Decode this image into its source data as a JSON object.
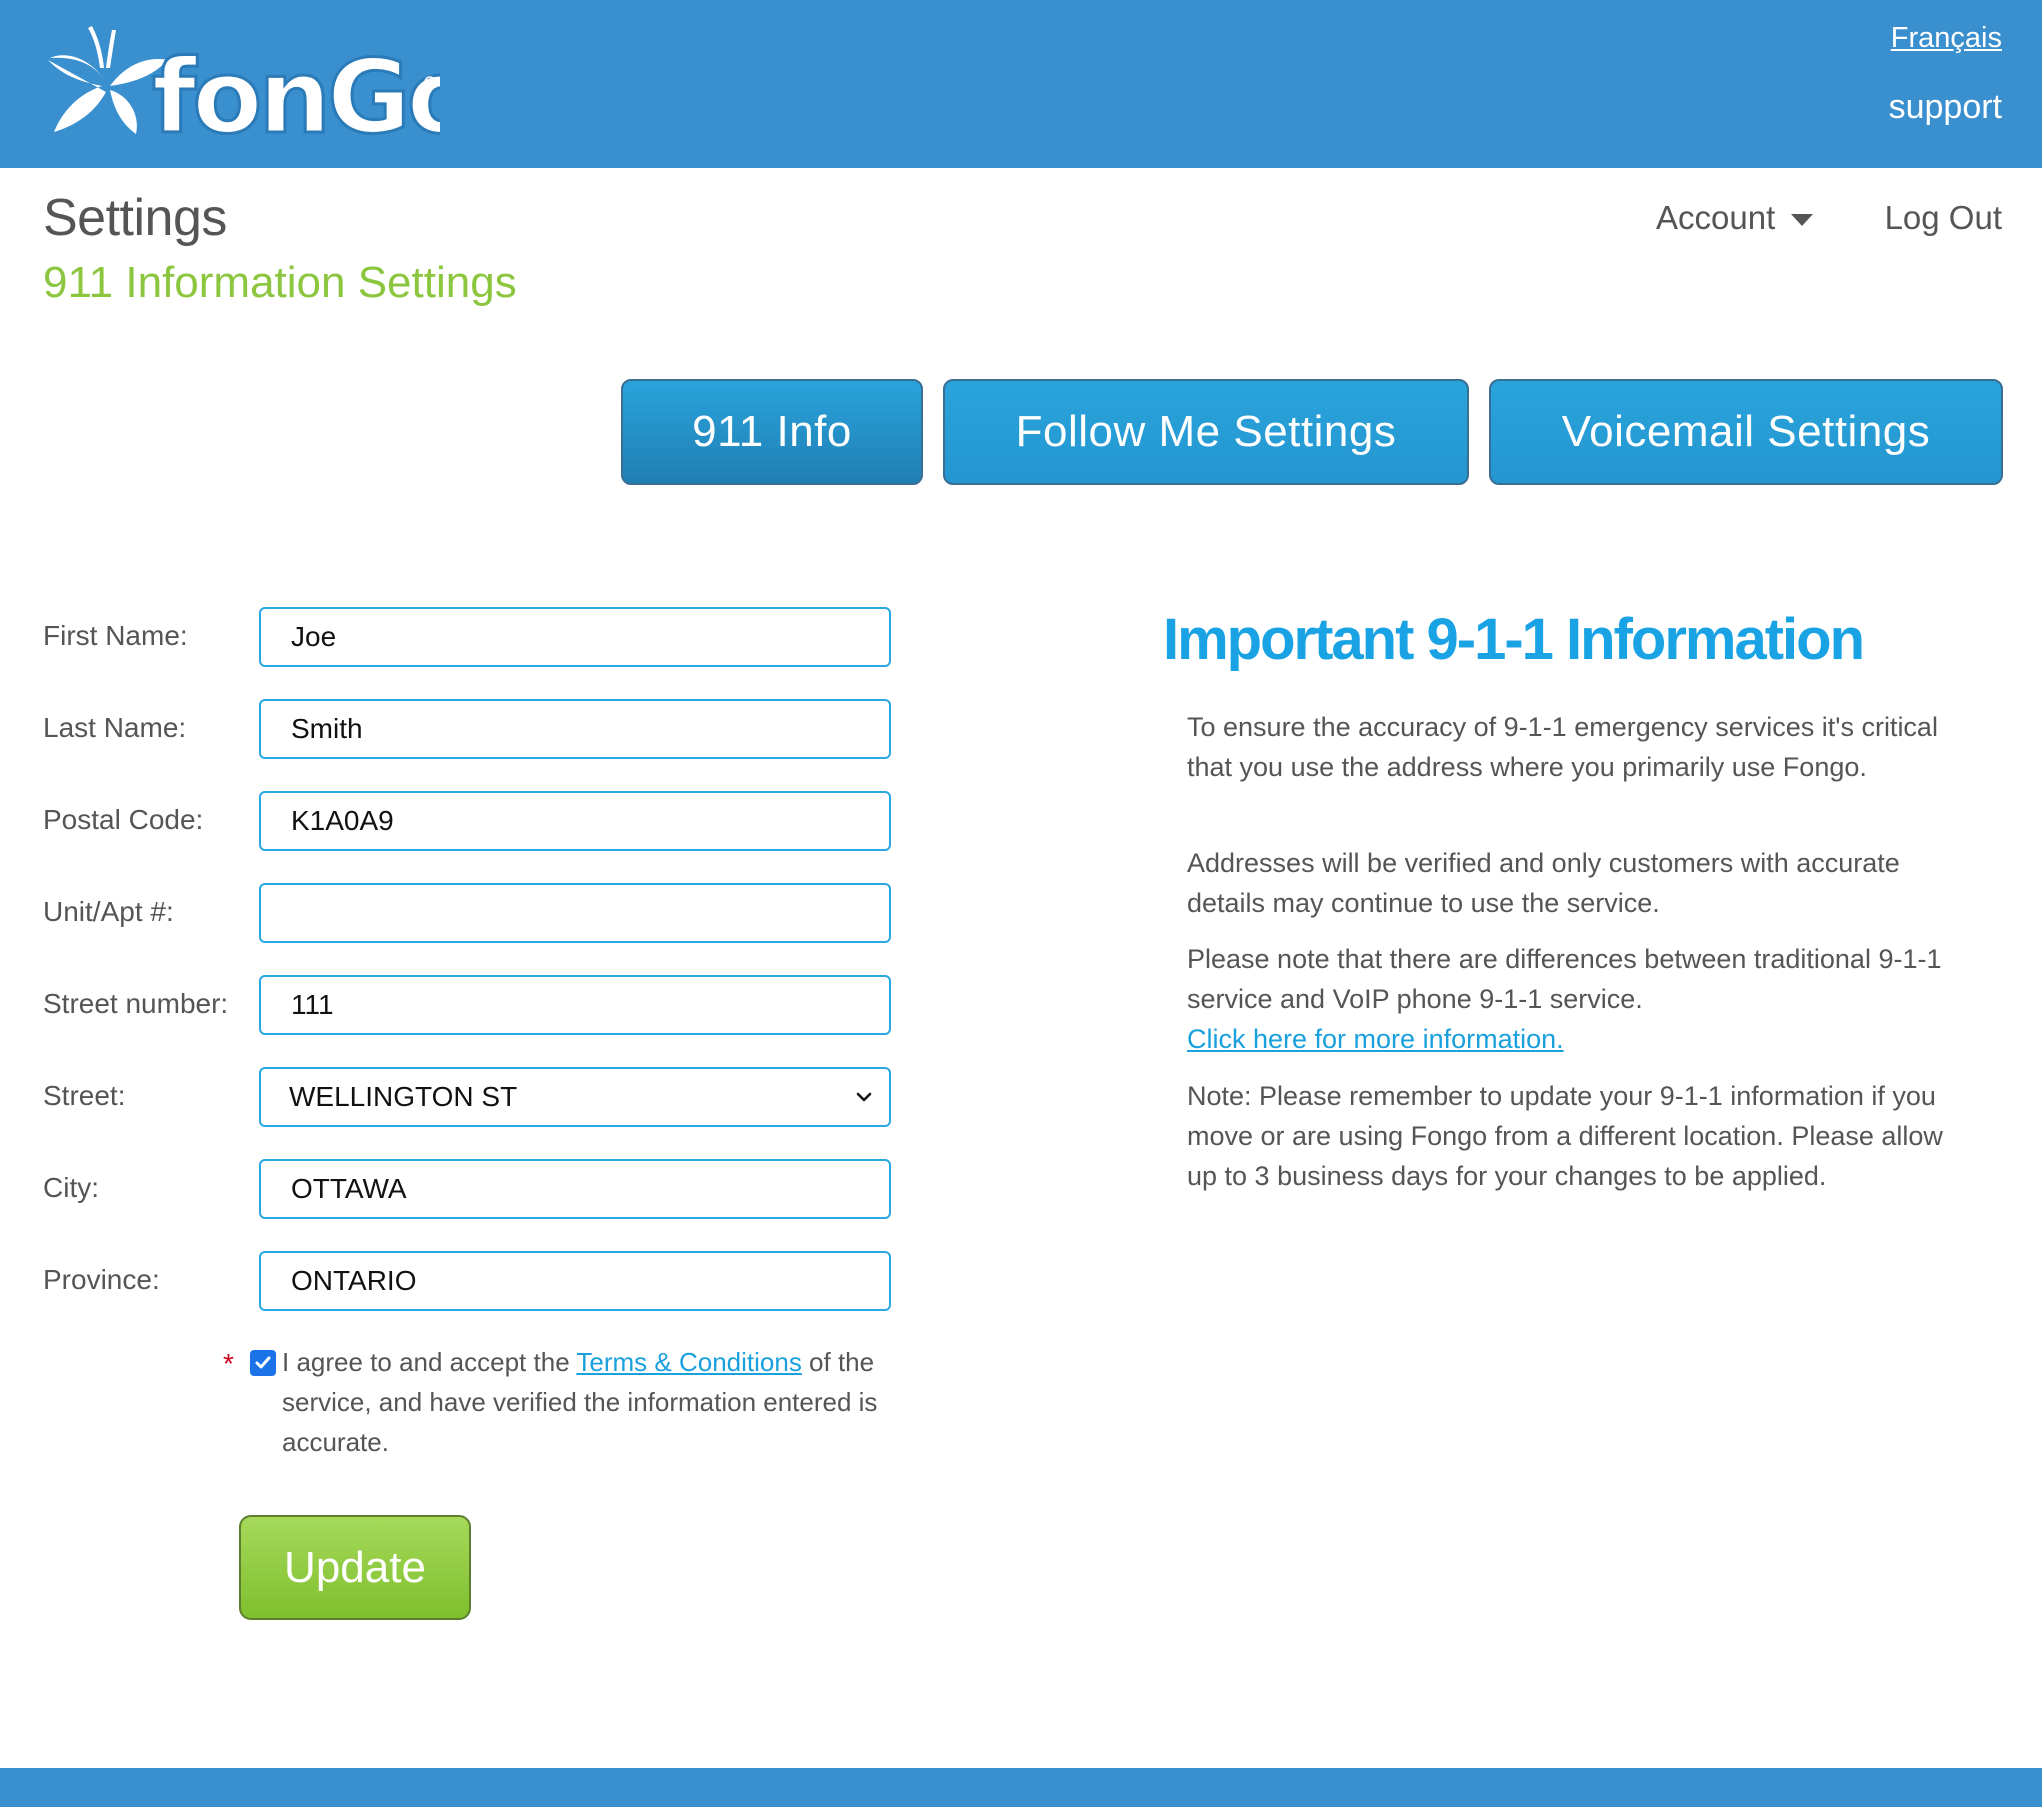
{
  "header": {
    "logo_text": "fongo",
    "language_link": "Français",
    "support_link": "support"
  },
  "page": {
    "title": "Settings",
    "subtitle": "911 Information Settings"
  },
  "nav": {
    "account_label": "Account",
    "logout_label": "Log Out"
  },
  "tabs": [
    {
      "label": "911 Info",
      "active": true
    },
    {
      "label": "Follow Me Settings",
      "active": false
    },
    {
      "label": "Voicemail Settings",
      "active": false
    }
  ],
  "form": {
    "first_name": {
      "label": "First Name:",
      "value": "Joe"
    },
    "last_name": {
      "label": "Last Name:",
      "value": "Smith"
    },
    "postal_code": {
      "label": "Postal Code:",
      "value": "K1A0A9"
    },
    "unit": {
      "label": "Unit/Apt #:",
      "value": ""
    },
    "street_number": {
      "label": "Street number:",
      "value": "111"
    },
    "street": {
      "label": "Street:",
      "value": "WELLINGTON ST"
    },
    "city": {
      "label": "City:",
      "value": "OTTAWA"
    },
    "province": {
      "label": "Province:",
      "value": "ONTARIO"
    },
    "agree": {
      "required_marker": "*",
      "checked": true,
      "text_before": "I agree to and accept the ",
      "terms_link": "Terms & Conditions",
      "text_after": " of the service, and have verified the information entered is accurate."
    },
    "update_label": "Update"
  },
  "info": {
    "title": "Important 9-1-1 Information",
    "para1": "To ensure the accuracy of 9-1-1 emergency services it's critical that you use the address where you primarily use Fongo.",
    "para2": "Addresses will be verified and only customers with accurate details may continue to use the service.",
    "para3": "Please note that there are differences between traditional 9-1-1 service and VoIP phone 9-1-1 service.",
    "more_info_link": "Click here for more information.",
    "para4": "Note: Please remember to update your 9-1-1 information if you move or are using Fongo from a different location. Please allow up to 3 business days for your changes to be applied."
  },
  "colors": {
    "header_blue": "#3a8fcf",
    "tab_blue": "#2aa3db",
    "accent_green": "#8cc63f",
    "info_title_blue": "#1aa3e4",
    "input_border": "#29a8e0"
  }
}
